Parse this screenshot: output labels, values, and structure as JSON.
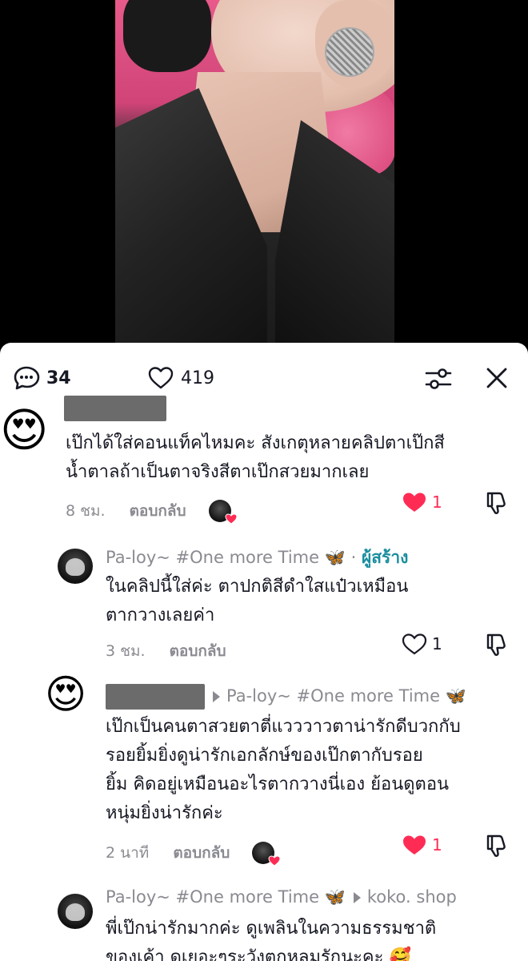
{
  "stats": {
    "comments": "34",
    "likes": "419"
  },
  "comments": [
    {
      "username": "",
      "avatar_emoji": "😍",
      "text_line1": "เป๊กได้ใส่คอนแท็คไหมคะ สังเกตุหลายคลิปตาเป๊กสี",
      "text_line2": "น้ำตาลถ้าเป็นตาจริงสีตาเป๊กสวยมากเลย",
      "time": "8 ชม.",
      "reply_label": "ตอบกลับ",
      "like_count": "1"
    },
    {
      "username": "Pa-loy~ #One more Time 🦋",
      "dot": "·",
      "creator_label": "ผู้สร้าง",
      "text_line1": "ในคลิปนี้ใส่ค่ะ ตาปกติสีดำใสแป๋วเหมือน",
      "text_line2": "ตากวางเลยค่า",
      "time": "3 ชม.",
      "reply_label": "ตอบกลับ",
      "like_count": "1"
    },
    {
      "username": "",
      "avatar_emoji": "😍",
      "reply_to": "Pa-loy~ #One more Time 🦋",
      "text_line1": "เป๊กเป็นคนตาสวยตาตี่แวววาวตาน่ารักดีบวกกับ",
      "text_line2": "รอยยิ้มยิ่งดูน่ารักเอกลักษ์ของเป๊กตากับรอย",
      "text_line3": "ยิ้ม คิดอยู่เหมือนอะไรตากวางนี่เอง ย้อนดูตอน",
      "text_line4": "หนุ่มยิ่งน่ารักค่ะ",
      "time": "2 นาที",
      "reply_label": "ตอบกลับ",
      "like_count": "1"
    },
    {
      "username": "Pa-loy~ #One more Time 🦋",
      "reply_to": "koko. shop",
      "text_line1": "พี่เป๊กน่ารักมากค่ะ ดูเพลินในความธรรมชาติ",
      "text_line2": "ของเค้า ดูเยอะๆระวังตกหลุมรักนะคะ 🥰"
    }
  ],
  "colors": {
    "like_red": "#fe2c55",
    "creator_teal": "#1a8e9e",
    "muted": "#8a8b91",
    "text": "#161823"
  },
  "icons": {
    "comments": "speech-bubble-icon",
    "likes": "heart-outline-icon",
    "filter": "sliders-icon",
    "close": "close-icon",
    "dislike": "thumbs-down-icon"
  }
}
